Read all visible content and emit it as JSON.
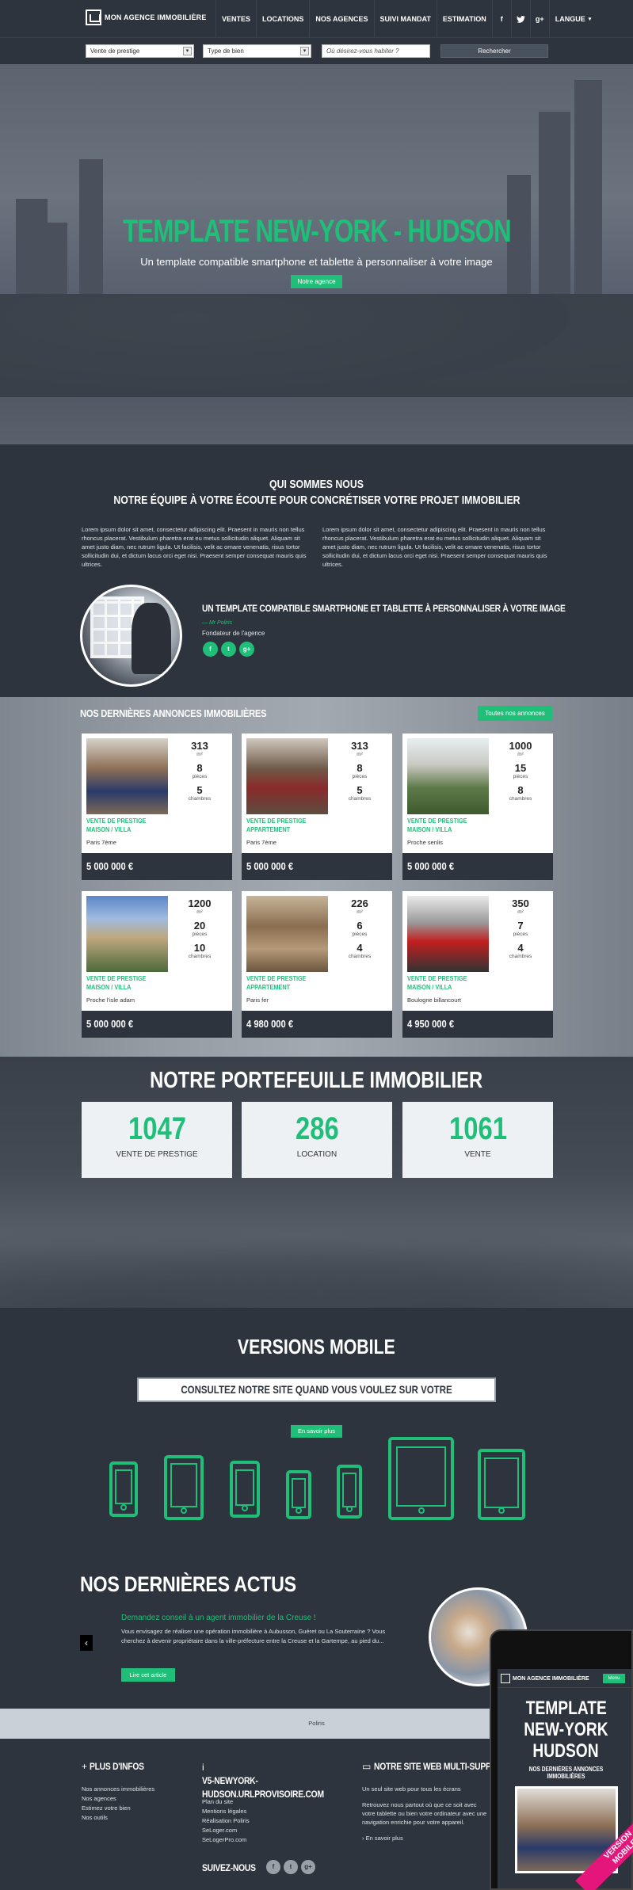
{
  "header": {
    "logo": "MON AGENCE IMMOBILIÈRE",
    "nav": [
      "VENTES",
      "LOCATIONS",
      "NOS AGENCES",
      "SUIVI MANDAT",
      "ESTIMATION"
    ],
    "language": "LANGUE"
  },
  "search": {
    "select1": "Vente de prestige",
    "select2": "Type de bien",
    "placeholder": "Où désirez-vous habiter ?",
    "button": "Rechercher"
  },
  "hero": {
    "title": "TEMPLATE NEW-YORK - HUDSON",
    "subtitle": "Un template compatible smartphone et tablette à personnaliser à votre image",
    "button": "Notre agence"
  },
  "about": {
    "title1": "QUI SOMMES NOUS",
    "title2": "NOTRE ÉQUIPE À VOTRE ÉCOUTE POUR CONCRÉTISER VOTRE PROJET IMMOBILIER",
    "para1": "Lorem ipsum dolor sit amet, consectetur adipiscing elit. Praesent in mauris non tellus rhoncus placerat. Vestibulum pharetra erat eu metus sollicitudin aliquet. Aliquam sit amet justo diam, nec rutrum ligula. Ut facilisis, velit ac ornare venenatis, risus tortor sollicitudin dui, et dictum lacus orci eget nisi. Praesent semper consequat mauris quis ultrices.",
    "para2": "Lorem ipsum dolor sit amet, consectetur adipiscing elit. Praesent in mauris non tellus rhoncus placerat. Vestibulum pharetra erat eu metus sollicitudin aliquet. Aliquam sit amet justo diam, nec rutrum ligula. Ut facilisis, velit ac ornare venenatis, risus tortor sollicitudin dui, et dictum lacus orci eget nisi. Praesent semper consequat mauris quis ultrices.",
    "quote_title": "UN TEMPLATE COMPATIBLE SMARTPHONE ET TABLETTE À PERSONNALISER À VOTRE IMAGE",
    "quote_author": "— Mr Poliris",
    "quote_role": "Fondateur de l'agence"
  },
  "listings": {
    "title": "NOS DERNIÈRES ANNONCES IMMOBILIÈRES",
    "all_button": "Toutes nos annonces",
    "surface_unit": "m²",
    "rooms_label": "pièces",
    "bedrooms_label": "chambres",
    "items": [
      {
        "surface": "313",
        "rooms": "8",
        "bedrooms": "5",
        "type": "VENTE DE PRESTIGE MAISON / VILLA",
        "location": "Paris 7ème",
        "price": "5 000 000 €"
      },
      {
        "surface": "313",
        "rooms": "8",
        "bedrooms": "5",
        "type": "VENTE DE PRESTIGE APPARTEMENT",
        "location": "Paris 7ème",
        "price": "5 000 000 €"
      },
      {
        "surface": "1000",
        "rooms": "15",
        "bedrooms": "8",
        "type": "VENTE DE PRESTIGE MAISON / VILLA",
        "location": "Proche senlis",
        "price": "5 000 000 €"
      },
      {
        "surface": "1200",
        "rooms": "20",
        "bedrooms": "10",
        "type": "VENTE DE PRESTIGE MAISON / VILLA",
        "location": "Proche l'isle adam",
        "price": "5 000 000 €"
      },
      {
        "surface": "226",
        "rooms": "6",
        "bedrooms": "4",
        "type": "VENTE DE PRESTIGE APPARTEMENT",
        "location": "Paris fer",
        "price": "4 980 000 €"
      },
      {
        "surface": "350",
        "rooms": "7",
        "bedrooms": "4",
        "type": "VENTE DE PRESTIGE MAISON / VILLA",
        "location": "Boulogne billancourt",
        "price": "4 950 000 €"
      }
    ]
  },
  "portfolio": {
    "title": "NOTRE PORTEFEUILLE IMMOBILIER",
    "items": [
      {
        "count": "1047",
        "label": "VENTE DE PRESTIGE"
      },
      {
        "count": "286",
        "label": "LOCATION"
      },
      {
        "count": "1061",
        "label": "VENTE"
      }
    ]
  },
  "mobile": {
    "title": "VERSIONS MOBILE",
    "subtitle": "CONSULTEZ NOTRE SITE QUAND VOUS VOULEZ SUR VOTRE MOBILE ET TABLETTE",
    "button": "En savoir plus"
  },
  "news": {
    "title": "NOS DERNIÈRES ACTUS",
    "headline": "Demandez conseil à un agent immobilier de la Creuse !",
    "text": "Vous envisagez de réaliser une opération immobilière à Aubusson, Guéret ou La Souterraine ? Vous cherchez à devenir propriétaire dans la ville-préfecture entre la Creuse et la Gartempe, au pied du...",
    "button": "Lire cet article"
  },
  "partners": {
    "text": "Poliris"
  },
  "footer": {
    "col1_title": "PLUS D'INFOS",
    "col1_links": [
      "Nos annonces immobilières",
      "Nos agences",
      "Estimez votre bien",
      "Nos outils"
    ],
    "col2_title": "V5-NEWYORK-HUDSON.URLPROVISOIRE.COM",
    "col2_links": [
      "Plan du site",
      "Mentions légales",
      "Réalisation Poliris",
      "SeLoger.com",
      "SeLogerPro.com"
    ],
    "col2_follow": "SUIVEZ-NOUS",
    "col3_title": "NOTRE SITE WEB MULTI-SUPPORT",
    "col3_sub": "Un seul site web pour tous les écrans",
    "col3_text": "Retrouvez nous partout où que ce soit avec votre tablette ou bien votre ordinateur avec une navigation enrichie pour votre appareil.",
    "col3_link": "En savoir plus"
  },
  "phone": {
    "logo": "MON AGENCE IMMOBILIÈRE",
    "menu": "Menu",
    "title_line1": "TEMPLATE",
    "title_line2": "NEW-YORK",
    "title_line3": "HUDSON",
    "subtitle": "NOS DERNIÈRES ANNONCES IMMOBILIÈRES",
    "ribbon_line1": "VERSION",
    "ribbon_line2": "MOBILE"
  },
  "colors": {
    "accent": "#1fbf7a",
    "dark": "#2e343d",
    "ribbon": "#e5167b"
  }
}
